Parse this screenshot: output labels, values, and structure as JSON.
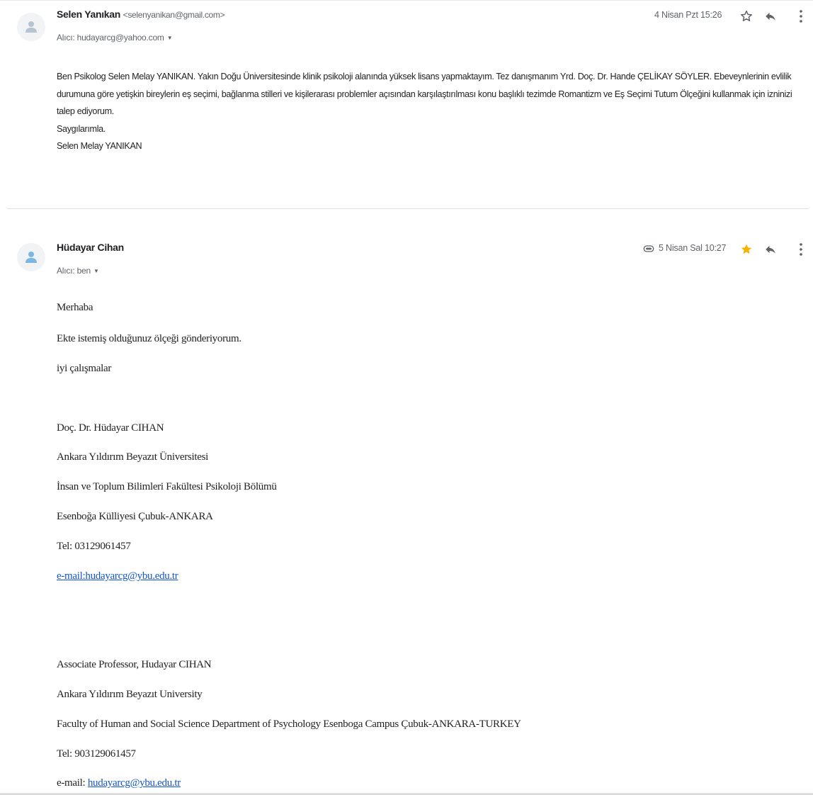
{
  "messages": [
    {
      "sender_name": "Selen Yanıkan",
      "sender_email": "<selenyanikan@gmail.com>",
      "recipient": "Alıcı: hudayarcg@yahoo.com",
      "date": "4 Nisan Pzt 15:26",
      "starred": false,
      "has_attachment": false,
      "body": [
        "Ben Psikolog Selen Melay YANIKAN. Yakın Doğu Üniversitesinde klinik psikoloji alanında yüksek lisans yapmaktayım. Tez danışmanım Yrd. Doç. Dr. Hande ÇELİKAY SÖYLER. Ebeveynlerinin evlilik durumuna göre yetişkin bireylerin eş seçimi, bağlanma stilleri ve kişilerarası problemler açısından karşılaştırılması konu başlıklı tezimde Romantizm ve Eş Seçimi Tutum Ölçeğini kullanmak için izninizi talep ediyorum.",
        "Saygılarımla.",
        "Selen Melay YANIKAN"
      ]
    },
    {
      "sender_name": "Hüdayar Cihan",
      "recipient": "Alıcı: ben",
      "date": "5 Nisan Sal 10:27",
      "starred": true,
      "has_attachment": true,
      "body": {
        "greeting": "Merhaba",
        "line_1": "Ekte istemiş olduğunuz ölçeği gönderiyorum.",
        "closing": "iyi çalışmalar",
        "sig_tr_name": "Doç. Dr. Hüdayar CIHAN",
        "sig_tr_university": "Ankara Yıldırım Beyazıt Üniversitesi",
        "sig_tr_faculty": "İnsan ve Toplum Bilimleri Fakültesi Psikoloji Bölümü",
        "sig_tr_address": "Esenboğa Külliyesi Çubuk-ANKARA",
        "sig_tr_tel": "Tel: 03129061457",
        "sig_tr_email": "e-mail:hudayarcg@ybu.edu.tr",
        "sig_en_name": "Associate Professor, Hudayar CIHAN",
        "sig_en_university": "Ankara Yıldırım Beyazıt University",
        "sig_en_faculty": "Faculty of Human and Social Science Department of Psychology Esenboga Campus Çubuk-ANKARA-TURKEY",
        "sig_en_tel": "Tel: 903129061457",
        "sig_en_email_label": "e-mail: ",
        "sig_en_email": "hudayarcg@ybu.edu.tr"
      }
    }
  ],
  "icons": {
    "avatar": "person-avatar-icon",
    "star_empty": "star-outline-icon",
    "star_filled": "star-filled-icon",
    "reply": "reply-icon",
    "more": "more-vert-icon",
    "attachment": "attachment-icon",
    "dropdown": "chevron-down-icon"
  },
  "colors": {
    "star_filled": "#f4b400",
    "link": "#1155cc",
    "secondary_text": "#5f6368",
    "icon": "#5f6368"
  }
}
